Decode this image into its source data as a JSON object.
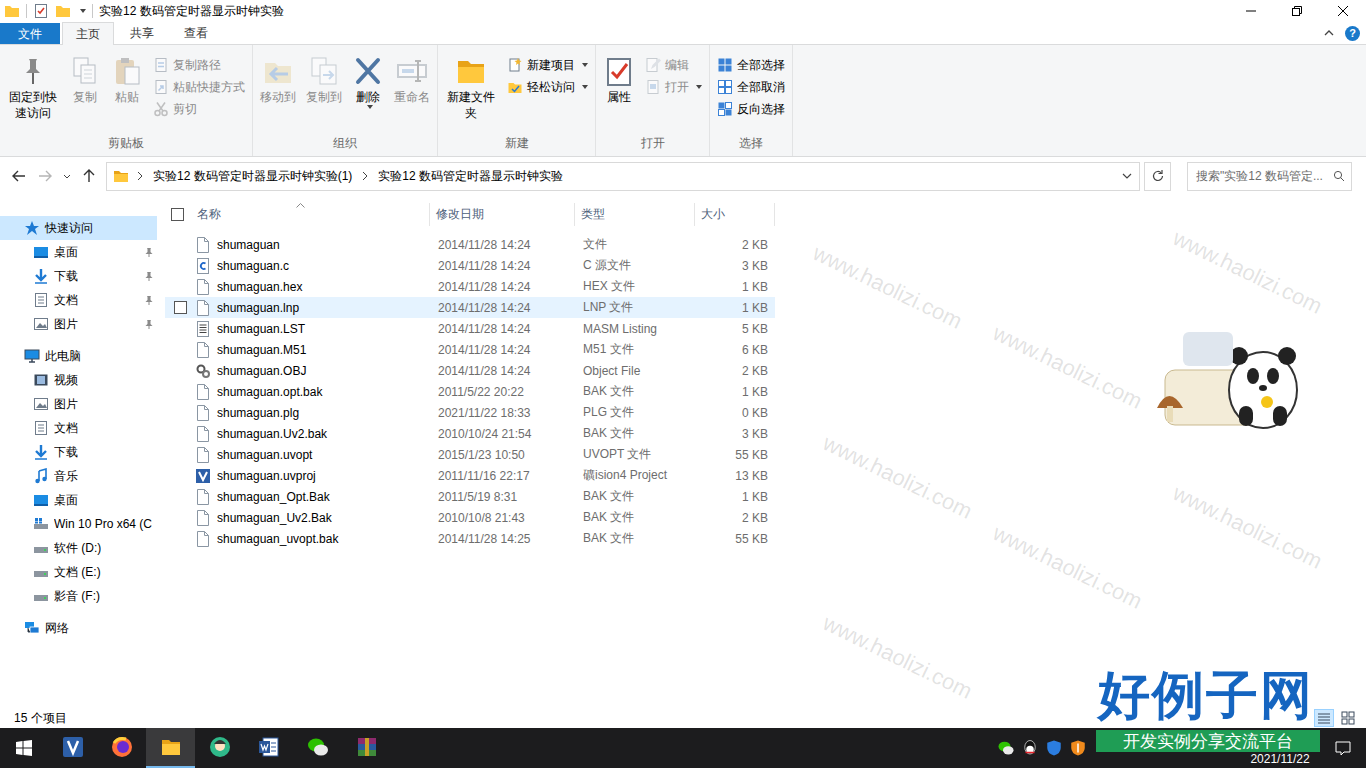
{
  "window": {
    "title": "实验12 数码管定时器显示时钟实验"
  },
  "ribbon_tabs": [
    {
      "label": "文件",
      "selected": false,
      "kind": "file-menu"
    },
    {
      "label": "主页",
      "selected": true,
      "kind": "tab"
    },
    {
      "label": "共享",
      "selected": false,
      "kind": "tab"
    },
    {
      "label": "查看",
      "selected": false,
      "kind": "tab"
    }
  ],
  "help": "?",
  "ribbon_groups": [
    {
      "label": "剪贴板",
      "items": [
        {
          "label": "固定到快速访问",
          "kind": "large",
          "disabled": false,
          "dropdown": false
        },
        {
          "label": "复制",
          "kind": "large",
          "disabled": true,
          "dropdown": false
        },
        {
          "label": "粘贴",
          "kind": "large",
          "disabled": true,
          "dropdown": false
        },
        {
          "label": "复制路径",
          "kind": "small",
          "disabled": true,
          "dropdown": false
        },
        {
          "label": "粘贴快捷方式",
          "kind": "small",
          "disabled": true,
          "dropdown": false
        },
        {
          "label": "剪切",
          "kind": "small",
          "disabled": true,
          "dropdown": false
        }
      ]
    },
    {
      "label": "组织",
      "items": [
        {
          "label": "移动到",
          "kind": "large",
          "disabled": true,
          "dropdown": false
        },
        {
          "label": "复制到",
          "kind": "large",
          "disabled": true,
          "dropdown": false
        },
        {
          "label": "删除",
          "kind": "large",
          "disabled": false,
          "dropdown": true
        },
        {
          "label": "重命名",
          "kind": "large",
          "disabled": true,
          "dropdown": false
        }
      ]
    },
    {
      "label": "新建",
      "items": [
        {
          "label": "新建文件夹",
          "kind": "large",
          "disabled": false,
          "dropdown": false
        },
        {
          "label": "新建项目",
          "kind": "small",
          "disabled": false,
          "dropdown": true
        },
        {
          "label": "轻松访问",
          "kind": "small",
          "disabled": false,
          "dropdown": true
        }
      ]
    },
    {
      "label": "打开",
      "items": [
        {
          "label": "属性",
          "kind": "large",
          "disabled": false,
          "dropdown": false
        },
        {
          "label": "编辑",
          "kind": "small",
          "disabled": true,
          "dropdown": false
        },
        {
          "label": "打开",
          "kind": "small",
          "disabled": true,
          "dropdown": true
        }
      ]
    },
    {
      "label": "选择",
      "items": [
        {
          "label": "全部选择",
          "kind": "small",
          "disabled": false,
          "dropdown": false
        },
        {
          "label": "全部取消",
          "kind": "small",
          "disabled": false,
          "dropdown": false
        },
        {
          "label": "反向选择",
          "kind": "small",
          "disabled": false,
          "dropdown": false
        }
      ]
    }
  ],
  "address": {
    "back_disabled": false,
    "forward_disabled": true,
    "crumbs": [
      "实验12 数码管定时器显示时钟实验(1)",
      "实验12 数码管定时器显示时钟实验"
    ],
    "search_placeholder": "搜索\"实验12 数码管定..."
  },
  "sidebar": {
    "sections": [
      {
        "label": "快速访问",
        "kind": "quick",
        "selected": true,
        "children": [
          {
            "label": "桌面",
            "kind": "desktop",
            "pinned": true
          },
          {
            "label": "下载",
            "kind": "download",
            "pinned": true
          },
          {
            "label": "文档",
            "kind": "document",
            "pinned": true
          },
          {
            "label": "图片",
            "kind": "picture",
            "pinned": true
          }
        ]
      },
      {
        "label": "此电脑",
        "kind": "pc",
        "selected": false,
        "children": [
          {
            "label": "视频",
            "kind": "video",
            "pinned": false
          },
          {
            "label": "图片",
            "kind": "picture",
            "pinned": false
          },
          {
            "label": "文档",
            "kind": "document",
            "pinned": false
          },
          {
            "label": "下载",
            "kind": "download",
            "pinned": false
          },
          {
            "label": "音乐",
            "kind": "music",
            "pinned": false
          },
          {
            "label": "桌面",
            "kind": "desktop",
            "pinned": false
          },
          {
            "label": "Win 10 Pro x64 (C",
            "kind": "drive-os",
            "pinned": false
          },
          {
            "label": "软件 (D:)",
            "kind": "drive",
            "pinned": false
          },
          {
            "label": "文档 (E:)",
            "kind": "drive",
            "pinned": false
          },
          {
            "label": "影音 (F:)",
            "kind": "drive",
            "pinned": false
          }
        ]
      },
      {
        "label": "网络",
        "kind": "network",
        "selected": false,
        "children": []
      }
    ]
  },
  "table": {
    "columns": [
      {
        "label": "名称",
        "sorted": true
      },
      {
        "label": "修改日期",
        "sorted": false
      },
      {
        "label": "类型",
        "sorted": false
      },
      {
        "label": "大小",
        "sorted": false
      }
    ],
    "rows": [
      {
        "name": "shumaguan",
        "date": "2014/11/28 14:24",
        "type": "文件",
        "size": "2 KB",
        "kind": "file",
        "hovered": false
      },
      {
        "name": "shumaguan.c",
        "date": "2014/11/28 14:24",
        "type": "C 源文件",
        "size": "3 KB",
        "kind": "c",
        "hovered": false
      },
      {
        "name": "shumaguan.hex",
        "date": "2014/11/28 14:24",
        "type": "HEX 文件",
        "size": "1 KB",
        "kind": "file",
        "hovered": false
      },
      {
        "name": "shumaguan.lnp",
        "date": "2014/11/28 14:24",
        "type": "LNP 文件",
        "size": "1 KB",
        "kind": "file",
        "hovered": true
      },
      {
        "name": "shumaguan.LST",
        "date": "2014/11/28 14:24",
        "type": "MASM Listing",
        "size": "5 KB",
        "kind": "listing",
        "hovered": false
      },
      {
        "name": "shumaguan.M51",
        "date": "2014/11/28 14:24",
        "type": "M51 文件",
        "size": "6 KB",
        "kind": "file",
        "hovered": false
      },
      {
        "name": "shumaguan.OBJ",
        "date": "2014/11/28 14:24",
        "type": "Object File",
        "size": "2 KB",
        "kind": "object",
        "hovered": false
      },
      {
        "name": "shumaguan.opt.bak",
        "date": "2011/5/22 20:22",
        "type": "BAK 文件",
        "size": "1 KB",
        "kind": "file",
        "hovered": false
      },
      {
        "name": "shumaguan.plg",
        "date": "2021/11/22 18:33",
        "type": "PLG 文件",
        "size": "0 KB",
        "kind": "file",
        "hovered": false
      },
      {
        "name": "shumaguan.Uv2.bak",
        "date": "2010/10/24 21:54",
        "type": "BAK 文件",
        "size": "3 KB",
        "kind": "file",
        "hovered": false
      },
      {
        "name": "shumaguan.uvopt",
        "date": "2015/1/23 10:50",
        "type": "UVOPT 文件",
        "size": "55 KB",
        "kind": "file",
        "hovered": false
      },
      {
        "name": "shumaguan.uvproj",
        "date": "2011/11/16 22:17",
        "type": "礦ision4 Project",
        "size": "13 KB",
        "kind": "uvproj",
        "hovered": false
      },
      {
        "name": "shumaguan_Opt.Bak",
        "date": "2011/5/19 8:31",
        "type": "BAK 文件",
        "size": "1 KB",
        "kind": "file",
        "hovered": false
      },
      {
        "name": "shumaguan_Uv2.Bak",
        "date": "2010/10/8 21:43",
        "type": "BAK 文件",
        "size": "2 KB",
        "kind": "file",
        "hovered": false
      },
      {
        "name": "shumaguan_uvopt.bak",
        "date": "2014/11/28 14:25",
        "type": "BAK 文件",
        "size": "55 KB",
        "kind": "file",
        "hovered": false
      }
    ]
  },
  "status_bar": {
    "count": "15 个项目",
    "views": [
      {
        "kind": "details",
        "selected": true
      },
      {
        "kind": "large-icons",
        "selected": false
      }
    ]
  },
  "taskbar": {
    "apps": [
      {
        "kind": "vision",
        "selected": false
      },
      {
        "kind": "firefox",
        "selected": false
      },
      {
        "kind": "explorer",
        "selected": true
      },
      {
        "kind": "app",
        "selected": false
      },
      {
        "kind": "word",
        "selected": false
      },
      {
        "kind": "wechat",
        "selected": false
      },
      {
        "kind": "winrar",
        "selected": false
      }
    ],
    "tray": [
      {
        "kind": "wechat"
      },
      {
        "kind": "qq"
      },
      {
        "kind": "shield"
      },
      {
        "kind": "shield-orange"
      }
    ],
    "clock": "2021/11/22"
  },
  "overlay": {
    "watermark": "www.haolizi.com",
    "logo": "好例子网",
    "slogan": "开发实例分享交流平台"
  }
}
